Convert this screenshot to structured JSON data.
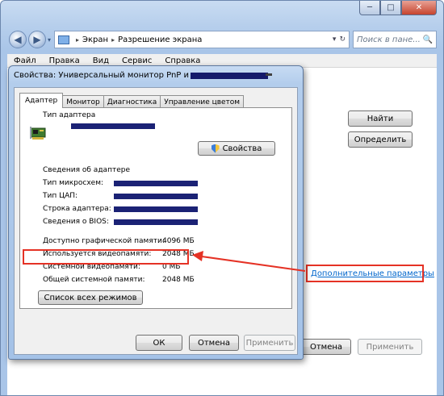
{
  "window": {
    "caption_min": "─",
    "caption_max": "□",
    "caption_close": "✕"
  },
  "nav": {
    "back_icon": "◀",
    "forward_icon": "▶",
    "dropdown_icon": "▾"
  },
  "breadcrumb": {
    "root_sep": "▸",
    "item1": "Экран",
    "sep": "▸",
    "item2": "Разрешение экрана",
    "dropdown_icon": "▾",
    "refresh_icon": "↻"
  },
  "search": {
    "placeholder": "Поиск в пане...",
    "icon": "🔍"
  },
  "menu": {
    "items": [
      "Файл",
      "Правка",
      "Вид",
      "Сервис",
      "Справка"
    ]
  },
  "main_buttons": {
    "find": "Найти",
    "detect": "Определить",
    "cancel": "Отмена",
    "apply": "Применить"
  },
  "advanced_link": "Дополнительные параметры",
  "dialog": {
    "title": "Свойства: Универсальный монитор PnP и",
    "tabs": [
      "Адаптер",
      "Монитор",
      "Диагностика",
      "Управление цветом"
    ],
    "adapter_type_label": "Тип адаптера",
    "properties_button": "Свойства",
    "adapter_info_heading": "Сведения об адаптере",
    "chip_type": "Тип микросхем:",
    "dac_type": "Тип ЦАП:",
    "adapter_string": "Строка адаптера:",
    "bios_info": "Сведения о BIOS:",
    "memory": [
      {
        "label": "Доступно графической памяти:",
        "value": "4096 МБ"
      },
      {
        "label": "Используется видеопамяти:",
        "value": "2048 МБ"
      },
      {
        "label": "Системной видеопамяти:",
        "value": "0 МБ"
      },
      {
        "label": "Общей системной памяти:",
        "value": "2048 МБ"
      }
    ],
    "list_modes_button": "Список всех режимов",
    "ok": "ОК",
    "cancel": "Отмена",
    "apply": "Применить"
  },
  "colors": {
    "highlight": "#e53225",
    "redaction": "#1b2275",
    "link": "#0066cc"
  }
}
